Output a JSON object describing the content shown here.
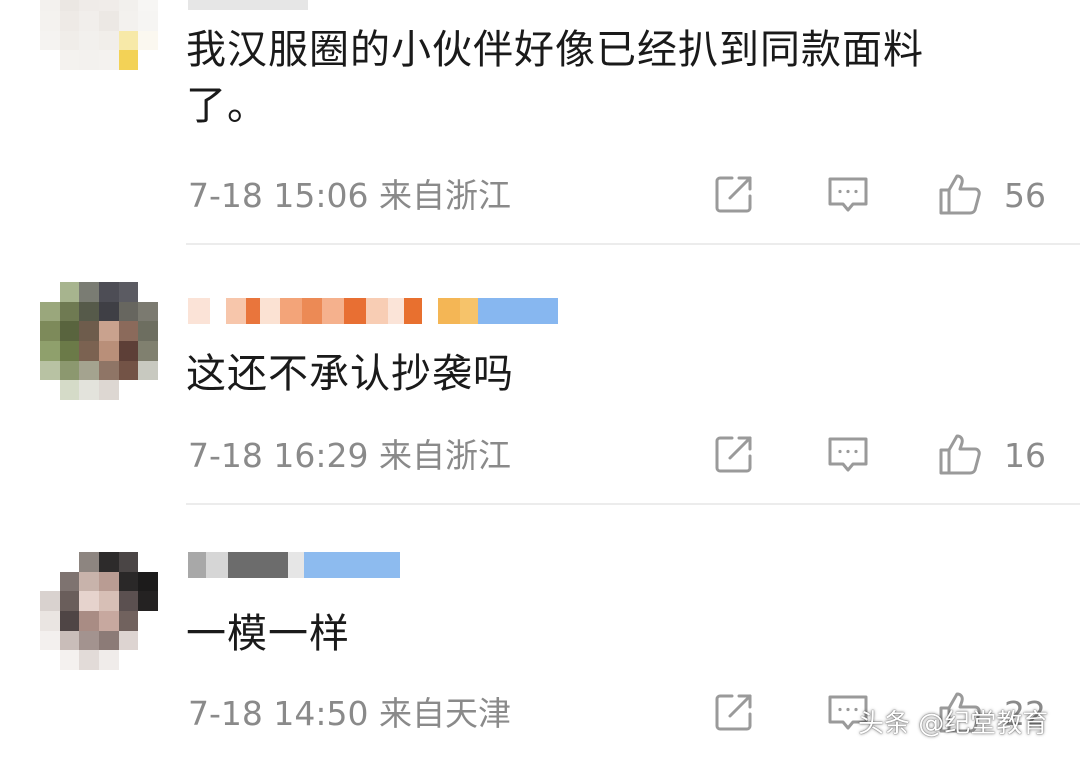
{
  "comments": [
    {
      "text": "我汉服圈的小伙伴好像已经扒到同款面料\n了。",
      "meta": "7-18 15:06  来自浙江",
      "likes": "56"
    },
    {
      "text": "这还不承认抄袭吗",
      "meta": "7-18 16:29  来自浙江",
      "likes": "16"
    },
    {
      "text": "一模一样",
      "meta": "7-18 14:50  来自天津",
      "likes": "22"
    }
  ],
  "watermark": "头条 @纪堂教育",
  "colors": {
    "text": "#1a1a1a",
    "meta": "#8a8a8a",
    "icon": "#9a9a9a",
    "divider": "#ececec"
  },
  "icons": {
    "share": "share-icon",
    "comment": "comment-bubble-icon",
    "like": "thumbs-up-icon"
  }
}
